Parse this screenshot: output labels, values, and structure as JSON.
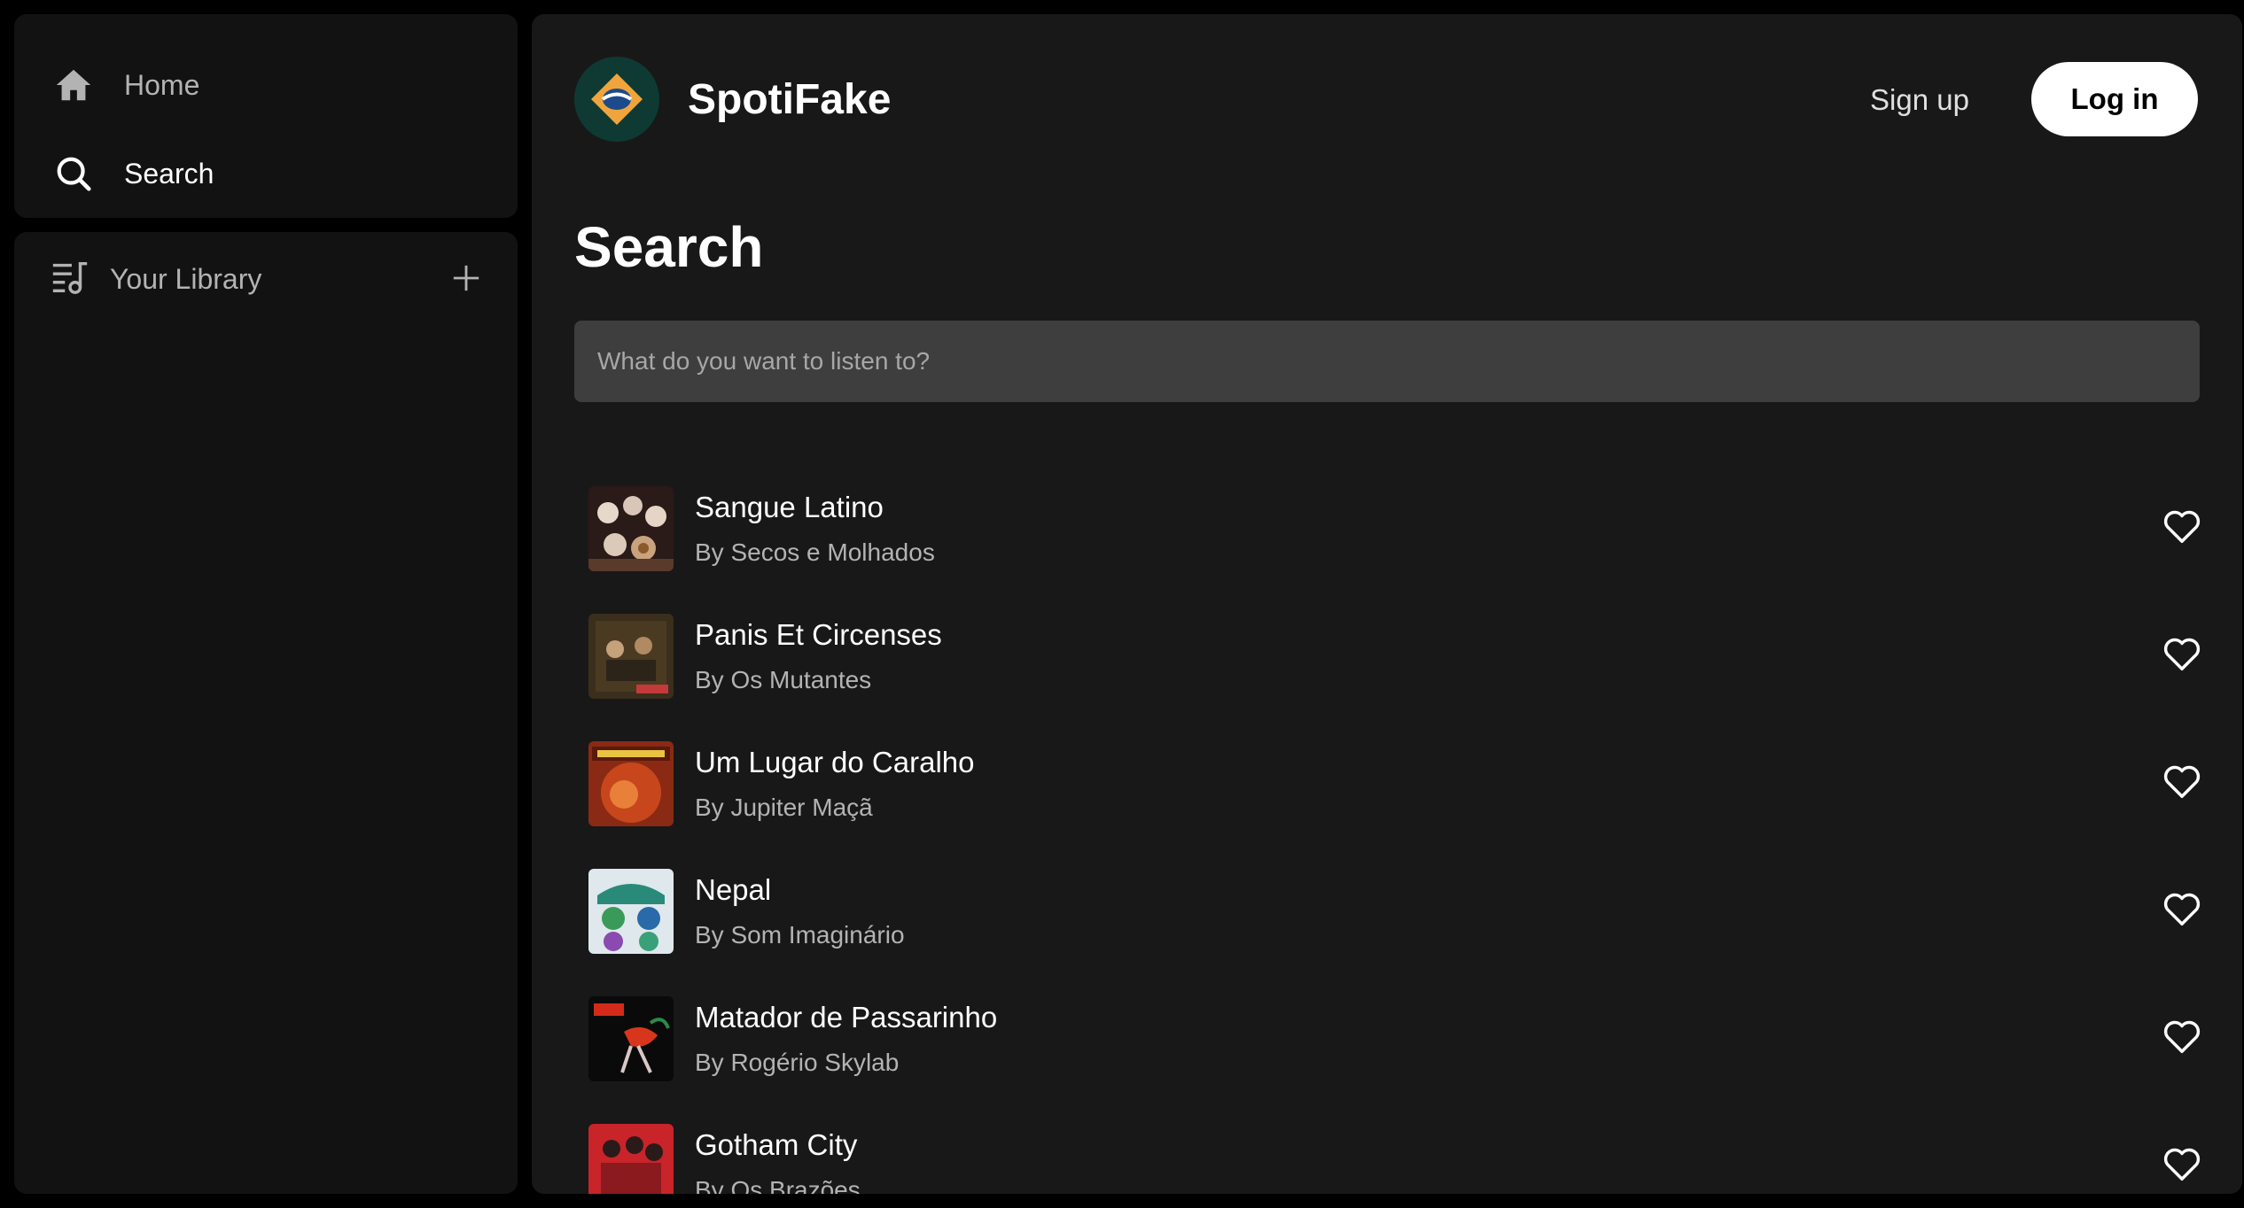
{
  "sidebar": {
    "nav": [
      {
        "label": "Home",
        "icon": "home-icon"
      },
      {
        "label": "Search",
        "icon": "search-icon"
      }
    ],
    "library": {
      "label": "Your Library",
      "icon": "library-icon",
      "add_icon": "plus-icon"
    }
  },
  "header": {
    "brand": "SpotiFake",
    "signup_label": "Sign up",
    "login_label": "Log in"
  },
  "main": {
    "title": "Search",
    "search_placeholder": "What do you want to listen to?",
    "results": [
      {
        "title": "Sangue Latino",
        "artist": "By Secos e Molhados"
      },
      {
        "title": "Panis Et Circenses",
        "artist": "By Os Mutantes"
      },
      {
        "title": "Um Lugar do Caralho",
        "artist": "By Jupiter Maçã"
      },
      {
        "title": "Nepal",
        "artist": "By Som Imaginário"
      },
      {
        "title": "Matador de Passarinho",
        "artist": "By Rogério Skylab"
      },
      {
        "title": "Gotham City",
        "artist": "By Os Brazões"
      }
    ]
  },
  "colors": {
    "background": "#000000",
    "panel": "#121212",
    "main": "#181818",
    "input": "#3e3e3e",
    "accent_logo": "#f0a53c"
  }
}
